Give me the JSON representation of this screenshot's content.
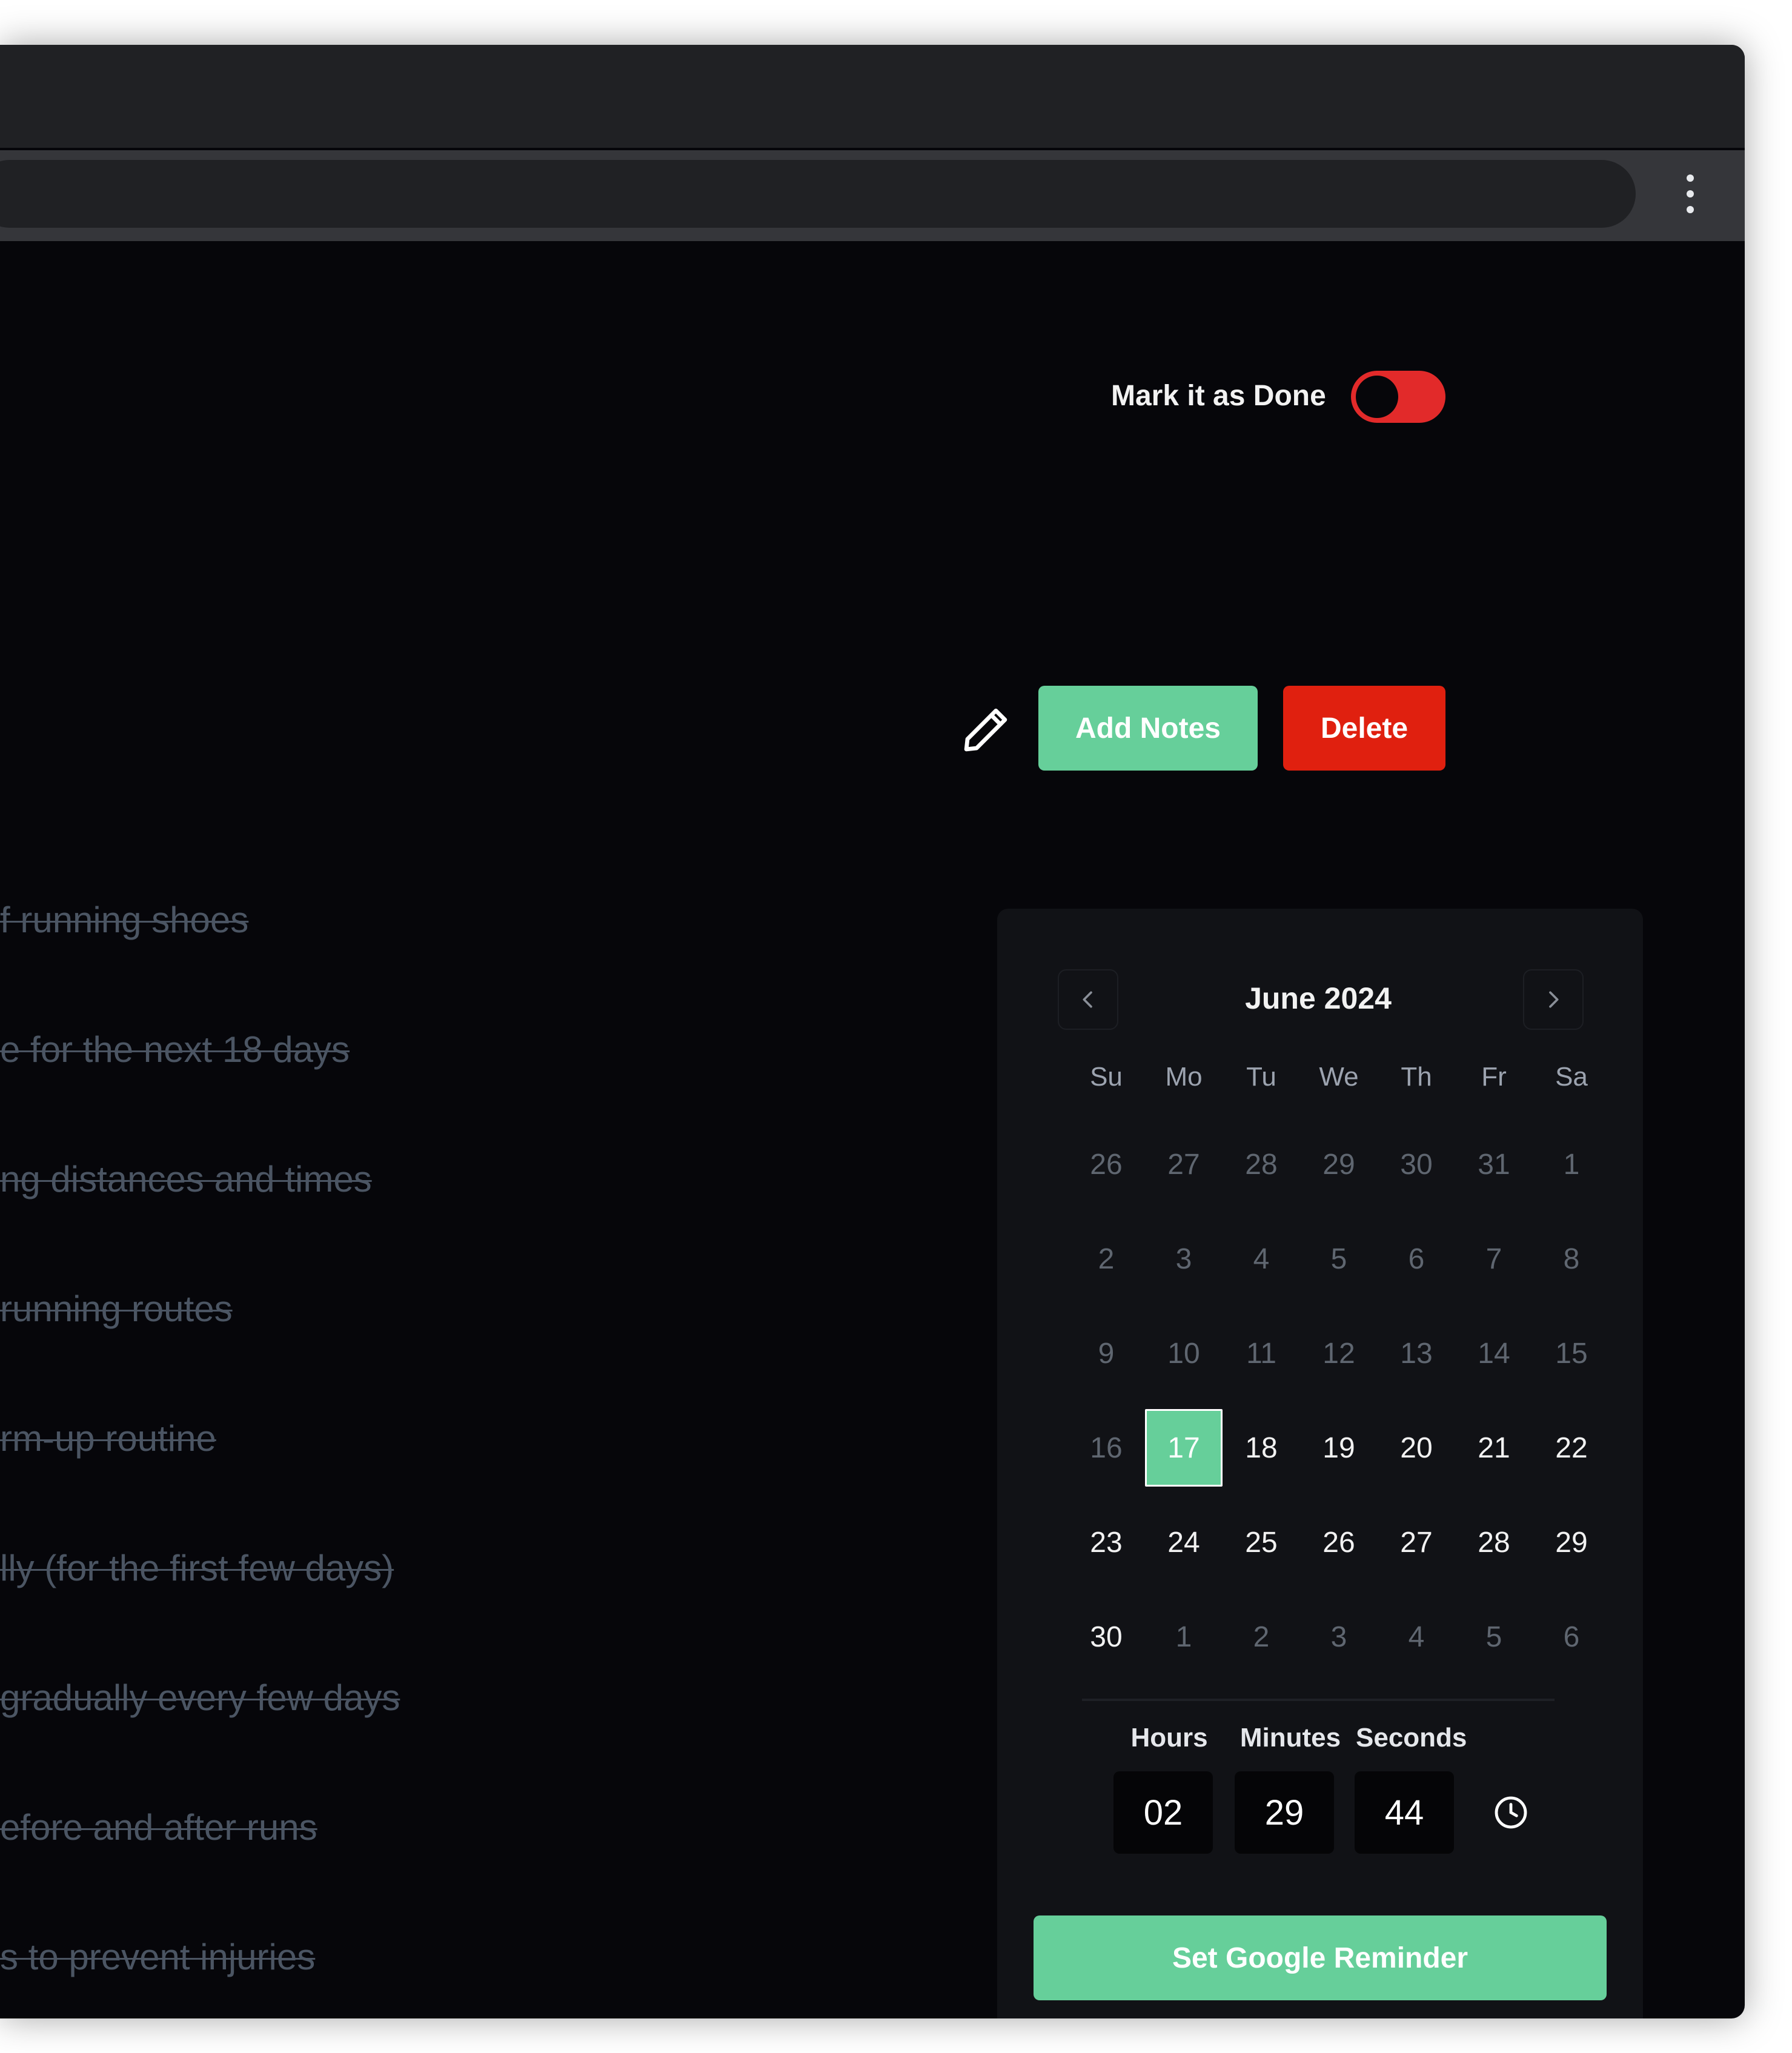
{
  "header": {
    "done_label": "Mark it as Done",
    "done_toggle_on": false,
    "add_notes_label": "Add Notes",
    "delete_label": "Delete"
  },
  "tasks": [
    "f running shoes",
    "e for the next 18 days",
    "ng distances and times",
    "running routes",
    "rm-up routine",
    "lly (for the first few days)",
    "gradually every few days",
    "efore and after runs",
    "s to prevent injuries"
  ],
  "calendar": {
    "month_label": "June 2024",
    "prev_icon": "chevron-left-icon",
    "next_icon": "chevron-right-icon",
    "weekdays": [
      "Su",
      "Mo",
      "Tu",
      "We",
      "Th",
      "Fr",
      "Sa"
    ],
    "weeks": [
      [
        "26",
        "27",
        "28",
        "29",
        "30",
        "31",
        "1"
      ],
      [
        "2",
        "3",
        "4",
        "5",
        "6",
        "7",
        "8"
      ],
      [
        "9",
        "10",
        "11",
        "12",
        "13",
        "14",
        "15"
      ],
      [
        "16",
        "17",
        "18",
        "19",
        "20",
        "21",
        "22"
      ],
      [
        "23",
        "24",
        "25",
        "26",
        "27",
        "28",
        "29"
      ],
      [
        "30",
        "1",
        "2",
        "3",
        "4",
        "5",
        "6"
      ]
    ],
    "selected_day": "17"
  },
  "time": {
    "hours_label": "Hours",
    "minutes_label": "Minutes",
    "seconds_label": "Seconds",
    "hours": "02",
    "minutes": "29",
    "seconds": "44"
  },
  "reminder_label": "Set Google Reminder",
  "colors": {
    "accent_green": "#66cf9a",
    "danger_red": "#e0200f",
    "toggle_red": "#e22a2a",
    "background": "#06060a",
    "panel": "#111216"
  }
}
